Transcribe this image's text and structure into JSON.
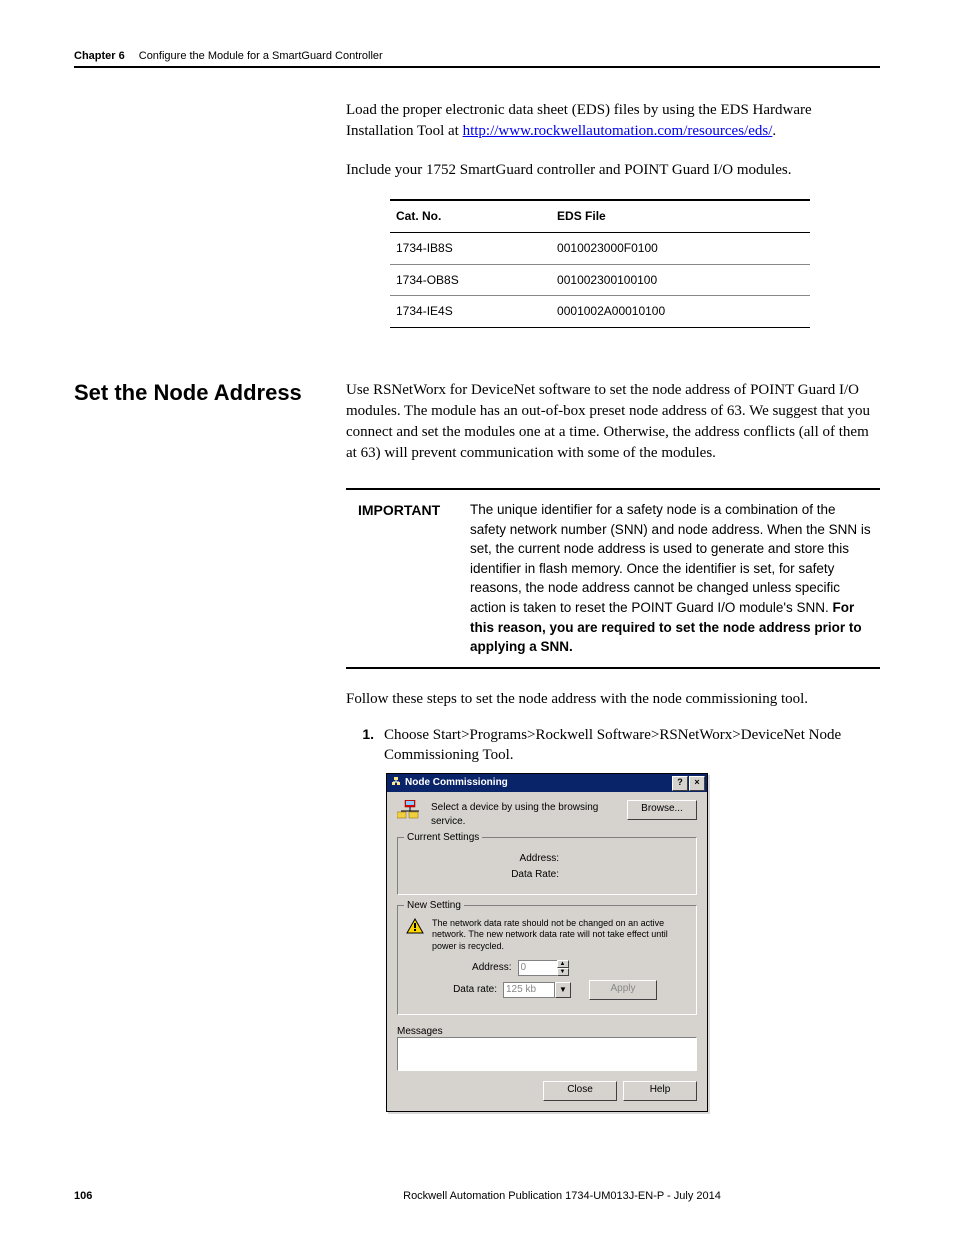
{
  "header": {
    "chapter_num": "Chapter 6",
    "chapter_title": "Configure the Module for a SmartGuard Controller"
  },
  "intro": {
    "p1_a": "Load the proper electronic data sheet (EDS) files by using the EDS Hardware Installation Tool at ",
    "p1_link": "http://www.rockwellautomation.com/resources/eds/",
    "p1_b": ".",
    "p2": "Include your 1752 SmartGuard controller and POINT Guard I/O modules."
  },
  "eds_table": {
    "headers": [
      "Cat. No.",
      "EDS File"
    ],
    "rows": [
      [
        "1734-IB8S",
        "0010023000F0100"
      ],
      [
        "1734-OB8S",
        "001002300100100"
      ],
      [
        "1734-IE4S",
        "0001002A00010100"
      ]
    ]
  },
  "section": {
    "heading": "Set the Node Address",
    "body_p1": "Use RSNetWorx for DeviceNet software to set the node address of POINT Guard I/O modules. The module has an out-of-box preset node address of 63. We suggest that you connect and set the modules one at a time. Otherwise, the address conflicts (all of them at 63) will prevent communication with some of the modules.",
    "important_label": "IMPORTANT",
    "important_text_a": "The unique identifier for a safety node is a combination of the safety network number (SNN) and node address. When the SNN is set, the current node address is used to generate and store this identifier in flash memory. Once the identifier is set, for safety reasons, the node address cannot be changed unless specific action is taken to reset the POINT Guard I/O module's SNN. ",
    "important_text_b": "For this reason, you are required to set the node address prior to applying a SNN.",
    "follow": "Follow these steps to set the node address with the node commissioning tool.",
    "step1_num": "1.",
    "step1_text": "Choose Start>Programs>Rockwell Software>RSNetWorx>DeviceNet Node Commissioning Tool."
  },
  "dialog": {
    "title": "Node Commissioning",
    "help_x": "?",
    "close_x": "×",
    "select_label": "Select a device by using the browsing service.",
    "browse": "Browse...",
    "current_legend": "Current Settings",
    "addr_label": "Address:",
    "rate_label": "Data Rate:",
    "new_legend": "New Setting",
    "warn": "The network data rate should not be changed on an active network. The new network data rate will not take effect until power is recycled.",
    "ns_addr_label": "Address:",
    "ns_addr_value": "0",
    "ns_rate_label": "Data rate:",
    "ns_rate_value": "125 kb",
    "apply": "Apply",
    "messages_legend": "Messages",
    "close_btn": "Close",
    "help_btn": "Help"
  },
  "footer": {
    "page": "106",
    "pub": "Rockwell Automation Publication 1734-UM013J-EN-P - July 2014"
  }
}
